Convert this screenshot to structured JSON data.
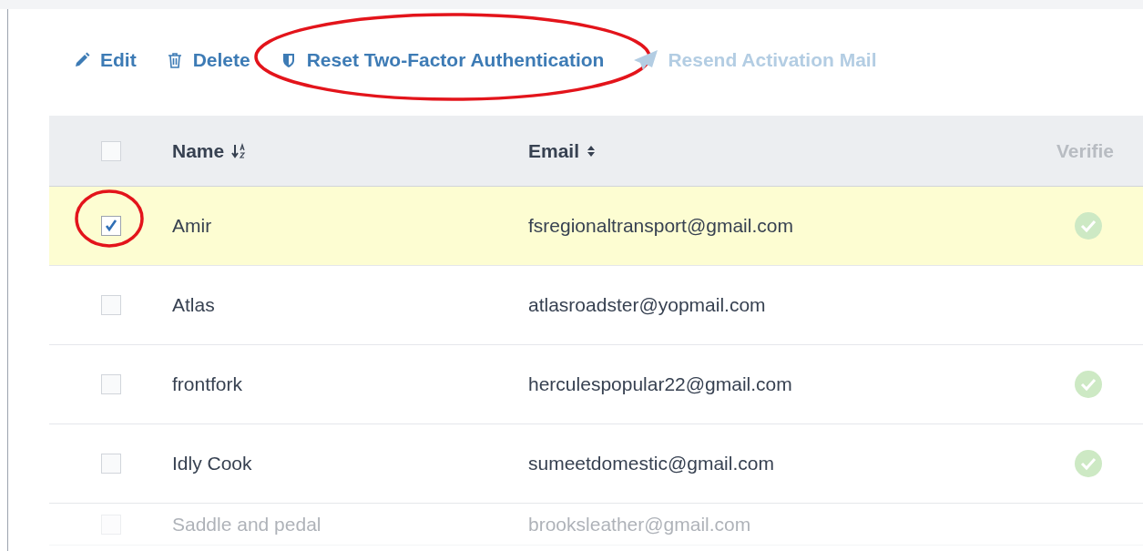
{
  "toolbar": [
    {
      "kind": "pencil",
      "label": "Edit",
      "disabled": false,
      "highlighted": false
    },
    {
      "kind": "trash",
      "label": "Delete",
      "disabled": false,
      "highlighted": false
    },
    {
      "kind": "shield",
      "label": "Reset Two-Factor Authentication",
      "disabled": false,
      "highlighted": true
    },
    {
      "kind": "plane",
      "label": "Resend Activation Mail",
      "disabled": true,
      "highlighted": false
    }
  ],
  "table": {
    "select_all": {
      "checked": false
    },
    "columns": [
      {
        "label": "Name",
        "sortable": true,
        "sorted": true
      },
      {
        "label": "Email",
        "sortable": true,
        "sorted": false
      },
      {
        "label": "Verifie",
        "sortable": false
      }
    ],
    "rows": [
      {
        "name": "Amir",
        "email": "fsregionaltransport@gmail.com",
        "verified": true,
        "selected": true,
        "highlighted": true
      },
      {
        "name": "Atlas",
        "email": "atlasroadster@yopmail.com",
        "verified": false,
        "selected": false,
        "highlighted": false
      },
      {
        "name": "frontfork",
        "email": "herculespopular22@gmail.com",
        "verified": true,
        "selected": false,
        "highlighted": false
      },
      {
        "name": "Idly Cook",
        "email": "sumeetdomestic@gmail.com",
        "verified": true,
        "selected": false,
        "highlighted": false
      },
      {
        "name": "Saddle and pedal",
        "email": "brooksleather@gmail.com",
        "verified": false,
        "selected": false,
        "highlighted": false
      }
    ]
  }
}
